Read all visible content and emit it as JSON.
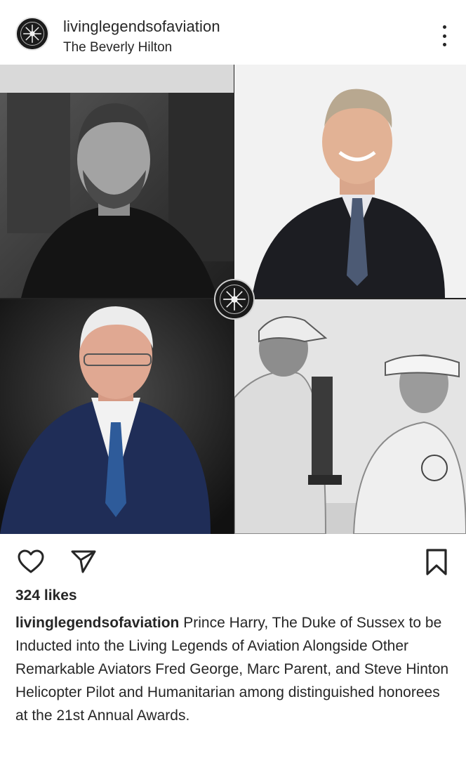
{
  "post": {
    "username": "livinglegendsofaviation",
    "location": "The Beverly Hilton",
    "likes": "324 likes",
    "caption_username": "livinglegendsofaviation",
    "caption_text": "Prince Harry, The Duke of Sussex to be Inducted into the Living Legends of Aviation Alongside Other Remarkable Aviators Fred George, Marc Parent, and Steve Hinton Helicopter Pilot and Humanitarian among distinguished honorees at the 21st Annual Awards."
  },
  "icons": {
    "avatar": "living-legends-logo",
    "more": "more-options-icon",
    "like": "heart-icon",
    "share": "send-icon",
    "save": "bookmark-icon"
  },
  "photos": [
    {
      "tile": "top-left",
      "style": "black-and-white portrait"
    },
    {
      "tile": "top-right",
      "style": "color portrait"
    },
    {
      "tile": "bottom-left",
      "style": "color portrait"
    },
    {
      "tile": "bottom-right",
      "style": "black-and-white photo"
    }
  ],
  "colors": {
    "text": "#262626",
    "background": "#ffffff"
  }
}
